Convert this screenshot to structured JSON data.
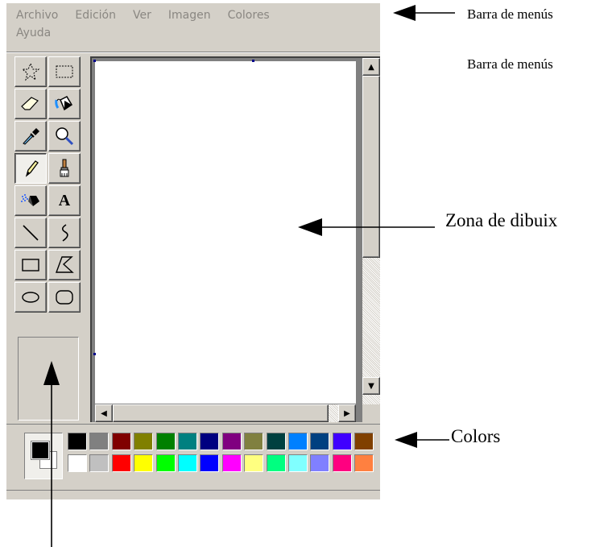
{
  "menubar": {
    "items": [
      "Archivo",
      "Edición",
      "Ver",
      "Imagen",
      "Colores",
      "Ayuda"
    ]
  },
  "toolbox": {
    "tools": [
      {
        "name": "free-form-select",
        "icon": "star-select-icon"
      },
      {
        "name": "rectangle-select",
        "icon": "rect-select-icon"
      },
      {
        "name": "eraser",
        "icon": "eraser-icon"
      },
      {
        "name": "fill",
        "icon": "fill-bucket-icon"
      },
      {
        "name": "pick-color",
        "icon": "eyedropper-icon"
      },
      {
        "name": "magnifier",
        "icon": "magnifier-icon"
      },
      {
        "name": "pencil",
        "icon": "pencil-icon",
        "pressed": true
      },
      {
        "name": "brush",
        "icon": "brush-icon"
      },
      {
        "name": "airbrush",
        "icon": "airbrush-icon"
      },
      {
        "name": "text",
        "icon": "text-icon",
        "label": "A"
      },
      {
        "name": "line",
        "icon": "line-icon"
      },
      {
        "name": "curve",
        "icon": "curve-icon"
      },
      {
        "name": "rectangle",
        "icon": "rectangle-icon"
      },
      {
        "name": "polygon",
        "icon": "polygon-icon"
      },
      {
        "name": "ellipse",
        "icon": "ellipse-icon"
      },
      {
        "name": "rounded-rectangle",
        "icon": "rounded-rect-icon"
      }
    ]
  },
  "palette": {
    "foreground": "#000000",
    "background": "#ffffff",
    "row1": [
      "#000000",
      "#808080",
      "#800000",
      "#808000",
      "#008000",
      "#008080",
      "#000080",
      "#800080",
      "#808040",
      "#004040",
      "#0080ff",
      "#004080",
      "#4000ff",
      "#804000"
    ],
    "row2": [
      "#ffffff",
      "#c0c0c0",
      "#ff0000",
      "#ffff00",
      "#00ff00",
      "#00ffff",
      "#0000ff",
      "#ff00ff",
      "#ffff80",
      "#00ff80",
      "#80ffff",
      "#8080ff",
      "#ff0080",
      "#ff8040"
    ]
  },
  "annotations": {
    "menubar_1": "Barra de menús",
    "menubar_2": "Barra de menús",
    "drawing_area": "Zona de dibuix",
    "colors": "Colors"
  }
}
